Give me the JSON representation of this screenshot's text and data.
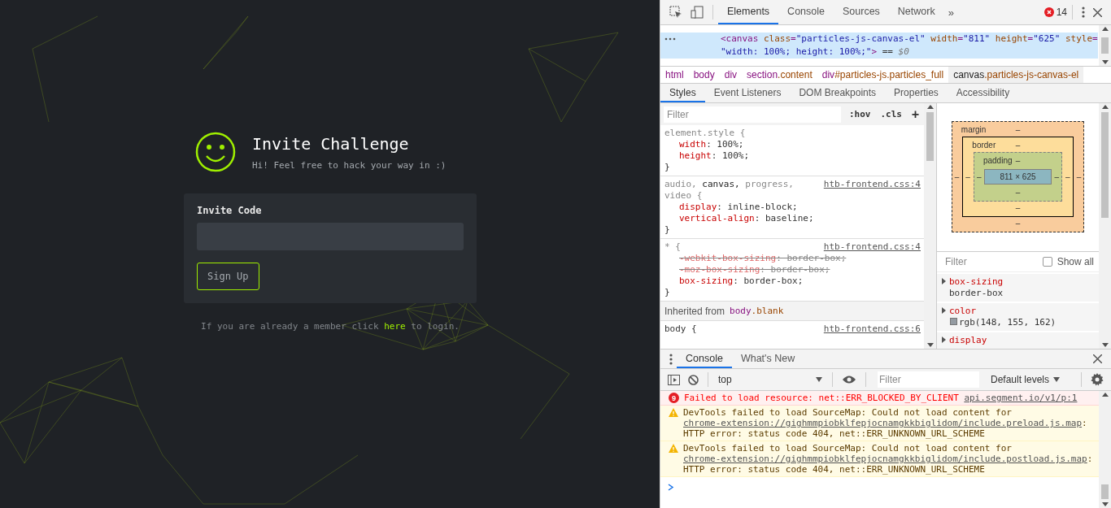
{
  "page": {
    "title": "Invite Challenge",
    "subtitle": "Hi! Feel free to hack your way in :)",
    "form": {
      "label": "Invite Code",
      "button": "Sign Up"
    },
    "footer": {
      "before": "If you are already a member click ",
      "link": "here",
      "after": " to login."
    }
  },
  "devtools": {
    "toolbar": {
      "tabs": [
        {
          "label": "Elements",
          "selected": true
        },
        {
          "label": "Console",
          "selected": false
        },
        {
          "label": "Sources",
          "selected": false
        },
        {
          "label": "Network",
          "selected": false
        }
      ],
      "more": "»",
      "error_count": "14"
    },
    "dom": [
      {
        "selected": true,
        "tokens": [
          {
            "kind": "tag",
            "text": "<canvas "
          },
          {
            "kind": "attr",
            "text": "class"
          },
          {
            "kind": "tag",
            "text": "="
          },
          {
            "kind": "value",
            "text": "\"particles-js-canvas-el\""
          },
          {
            "kind": "attr",
            "text": " width"
          },
          {
            "kind": "tag",
            "text": "="
          },
          {
            "kind": "value",
            "text": "\"811\""
          },
          {
            "kind": "attr",
            "text": " height"
          },
          {
            "kind": "tag",
            "text": "="
          },
          {
            "kind": "value",
            "text": "\"625\""
          },
          {
            "kind": "attr",
            "text": " style"
          },
          {
            "kind": "tag",
            "text": "="
          }
        ]
      },
      {
        "selected": true,
        "tokens": [
          {
            "kind": "value",
            "text": "\"width: 100%; height: 100%;\""
          },
          {
            "kind": "tag",
            "text": ">"
          },
          {
            "kind": "plain",
            "text": " == "
          },
          {
            "kind": "ref",
            "text": "$0"
          }
        ]
      }
    ],
    "breadcrumbs": [
      {
        "name": "html",
        "selected": false
      },
      {
        "name": "body",
        "selected": false
      },
      {
        "name": "div",
        "selected": false
      },
      {
        "name": "section",
        "cls": ".content",
        "selected": false
      },
      {
        "name": "div",
        "cls": "#particles-js.particles_full",
        "selected": false
      },
      {
        "name": "canvas",
        "cls": ".particles-js-canvas-el",
        "selected": true
      }
    ],
    "subtabs": [
      {
        "label": "Styles",
        "selected": true
      },
      {
        "label": "Event Listeners",
        "selected": false
      },
      {
        "label": "DOM Breakpoints",
        "selected": false
      },
      {
        "label": "Properties",
        "selected": false
      },
      {
        "label": "Accessibility",
        "selected": false
      }
    ],
    "styles": {
      "filter_placeholder": "Filter",
      "hov": ":hov",
      "cls": ".cls",
      "add": "+",
      "rules": [
        {
          "selector": [
            {
              "text": "element.style",
              "matched": false
            }
          ],
          "open": " {",
          "props": [
            {
              "name": "width",
              "rest": ": 100%;",
              "struck": false
            },
            {
              "name": "height",
              "rest": ": 100%;",
              "struck": false
            }
          ],
          "close": "}"
        },
        {
          "selector": [
            {
              "text": "audio, ",
              "matched": false
            },
            {
              "text": "canvas, ",
              "matched": true
            },
            {
              "text": "progress, video",
              "matched": false
            }
          ],
          "open": " {",
          "source": "htb-frontend.css:4",
          "props": [
            {
              "name": "display",
              "rest": ": inline-block;",
              "struck": false
            },
            {
              "name": "vertical-align",
              "rest": ": baseline;",
              "struck": false
            }
          ],
          "close": "}"
        },
        {
          "selector": [
            {
              "text": "*",
              "matched": false
            }
          ],
          "open": " {",
          "source": "htb-frontend.css:4",
          "props": [
            {
              "name": "-webkit-box-sizing",
              "rest": ": border-box;",
              "struck": true
            },
            {
              "name": "-moz-box-sizing",
              "rest": ": border-box;",
              "struck": true
            },
            {
              "name": "box-sizing",
              "rest": ": border-box;",
              "struck": false
            }
          ],
          "close": "}"
        }
      ],
      "inherited": {
        "label": "Inherited from",
        "tag": "body",
        "cls": ".blank"
      },
      "last_rule": {
        "selector": "body {",
        "source": "htb-frontend.css:6"
      }
    },
    "box_model": {
      "margin": {
        "label": "margin",
        "top": "–",
        "right": "–",
        "bottom": "–",
        "left": "–"
      },
      "border": {
        "label": "border",
        "top": "–",
        "right": "–",
        "bottom": "–",
        "left": "–"
      },
      "padding": {
        "label": "padding",
        "top": "–",
        "right": "–",
        "bottom": "–",
        "left": "–"
      },
      "content": "811 × 625"
    },
    "computed": {
      "filter_placeholder": "Filter",
      "show_all": {
        "label": "Show all",
        "checked": false
      },
      "props": [
        {
          "name": "box-sizing",
          "value": "border-box"
        },
        {
          "name": "color",
          "value": "rgb(148, 155, 162)",
          "color": "#949ba2"
        },
        {
          "name": "display"
        }
      ]
    },
    "console": {
      "tabs": [
        {
          "label": "Console",
          "selected": true
        },
        {
          "label": "What's New",
          "selected": false
        }
      ],
      "context": "top",
      "filter_placeholder": "Filter",
      "levels": "Default levels",
      "messages": [
        {
          "kind": "error",
          "count": "9",
          "text": "Failed to load resource: net::ERR_BLOCKED_BY_CLIENT ",
          "link": "api.segment.io/v1/p:1"
        },
        {
          "kind": "warning",
          "text": "DevTools failed to load SourceMap: Could not load content for ",
          "link": "chrome-extension://gighmmpiobklfepjocnamgkkbiglidom/include.preload.js.map",
          "rest": ": HTTP error: status code 404, net::ERR_UNKNOWN_URL_SCHEME"
        },
        {
          "kind": "warning",
          "text": "DevTools failed to load SourceMap: Could not load content for ",
          "link": "chrome-extension://gighmmpiobklfepjocnamgkkbiglidom/include.postload.js.map",
          "rest": ": HTTP error: status code 404, net::ERR_UNKNOWN_URL_SCHEME"
        }
      ]
    }
  }
}
